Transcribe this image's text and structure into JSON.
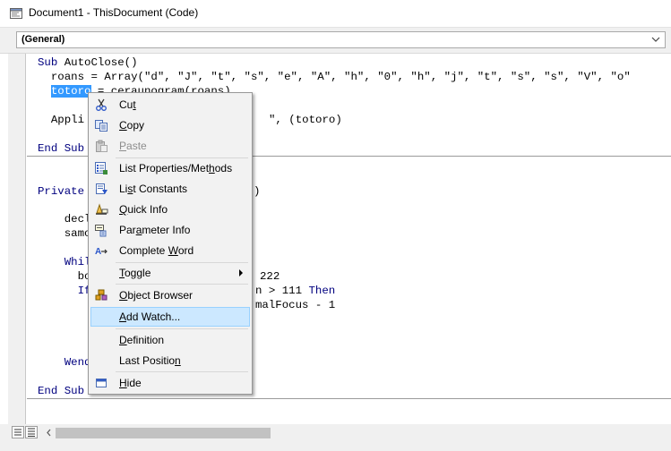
{
  "window": {
    "title": "Document1 - ThisDocument (Code)"
  },
  "toolbar": {
    "object_combo": "(General)"
  },
  "code": {
    "sub_kw": "Sub",
    "autoclose": " AutoClose()",
    "line2": "  roans = Array(\"d\", \"J\", \"t\", \"s\", \"e\", \"A\", \"h\", \"0\", \"h\", \"j\", \"t\", \"s\", \"s\", \"V\", \"o\"",
    "line3_sel": "totoro",
    "line3_rest": " = ceraunogram(roans)",
    "line4": "  Appli",
    "line4_tail": "\", (totoro)",
    "end_kw": "End",
    "end_sub_frag": " Sub",
    "private_kw": "Private",
    "private_tail": ")",
    "l_decl": "    decl",
    "l_samo": "    samo",
    "l_whil": "    Whil",
    "l_bo": "      bo",
    "l_bo_tail": "222",
    "l_if": "      If",
    "l_if_tail_a": "n > 111 ",
    "l_if_then": "Then",
    "l_if2_tail": "malFocus - 1",
    "l_e": "        E",
    "l_wend": "    Wend",
    "end_sub_frag2": " Sub"
  },
  "menu": {
    "cut": {
      "pre": "Cu",
      "u": "t",
      "post": ""
    },
    "copy": {
      "pre": "",
      "u": "C",
      "post": "opy"
    },
    "paste": {
      "pre": "",
      "u": "P",
      "post": "aste"
    },
    "list_props": {
      "pre": "List Properties/Met",
      "u": "h",
      "post": "ods"
    },
    "list_consts": {
      "pre": "Li",
      "u": "s",
      "post": "t Constants"
    },
    "quick_info": {
      "pre": "",
      "u": "Q",
      "post": "uick Info"
    },
    "param_info": {
      "pre": "Par",
      "u": "a",
      "post": "meter Info"
    },
    "complete_word": {
      "pre": "Complete ",
      "u": "W",
      "post": "ord"
    },
    "toggle": {
      "pre": "",
      "u": "T",
      "post": "oggle"
    },
    "object_browser": {
      "pre": "",
      "u": "O",
      "post": "bject Browser"
    },
    "add_watch": {
      "pre": "",
      "u": "A",
      "post": "dd Watch..."
    },
    "definition": {
      "pre": "",
      "u": "D",
      "post": "efinition"
    },
    "last_position": {
      "pre": "Last Positio",
      "u": "n",
      "post": ""
    },
    "hide": {
      "pre": "",
      "u": "H",
      "post": "ide"
    }
  },
  "colors": {
    "keyword": "#00007f",
    "selection": "#3399ff",
    "menu_highlight": "#cce8ff"
  }
}
